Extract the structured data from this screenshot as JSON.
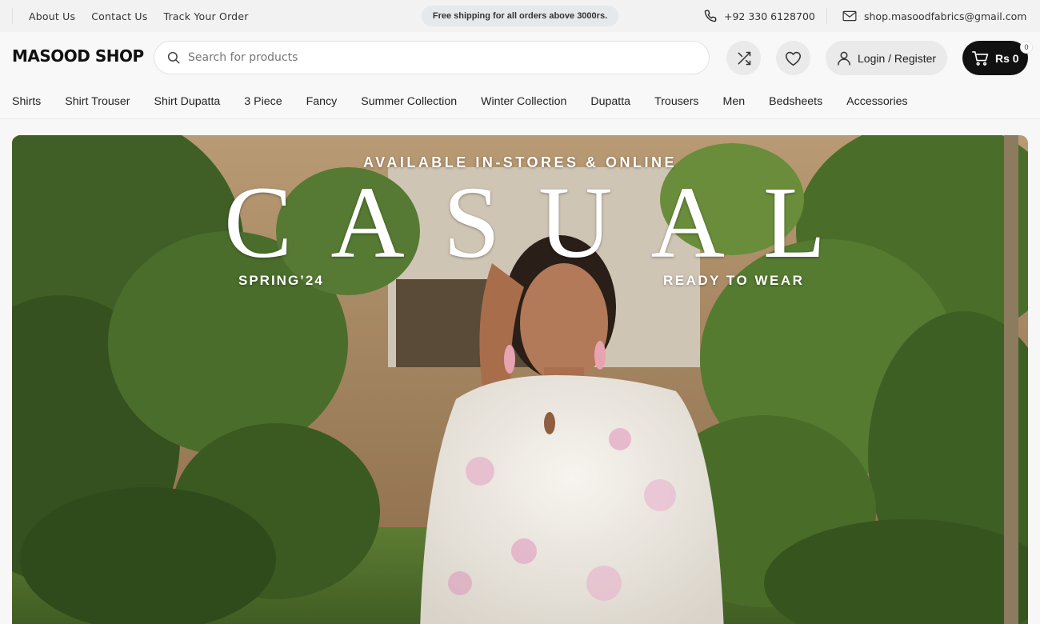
{
  "topbar": {
    "links": [
      "About Us",
      "Contact Us",
      "Track Your Order"
    ],
    "promo": "Free shipping for all orders above 3000rs.",
    "phone": "+92 330 6128700",
    "email": "shop.masoodfabrics@gmail.com",
    "icons": [
      "phone-icon",
      "mail-icon"
    ]
  },
  "header": {
    "logo": "MASOOD SHOP",
    "search_placeholder": "Search for products",
    "login_label": "Login / Register",
    "cart_total": "Rs 0",
    "cart_count": "0",
    "icons": [
      "search-icon",
      "shuffle-icon",
      "heart-icon",
      "user-icon",
      "cart-icon"
    ]
  },
  "nav": {
    "items": [
      "Shirts",
      "Shirt Trouser",
      "Shirt Dupatta",
      "3 Piece",
      "Fancy",
      "Summer Collection",
      "Winter Collection",
      "Dupatta",
      "Trousers",
      "Men",
      "Bedsheets",
      "Accessories"
    ]
  },
  "hero": {
    "top_line": "AVAILABLE IN-STORES & ONLINE",
    "headline": "CASUAL",
    "left_tag": "SPRING’24",
    "right_tag": "READY TO WEAR"
  },
  "colors": {
    "accent": "#111111",
    "topbar_bg": "#f2f2f2",
    "promo_bg": "#e6e9ec",
    "button_bg": "#eaeaea"
  }
}
